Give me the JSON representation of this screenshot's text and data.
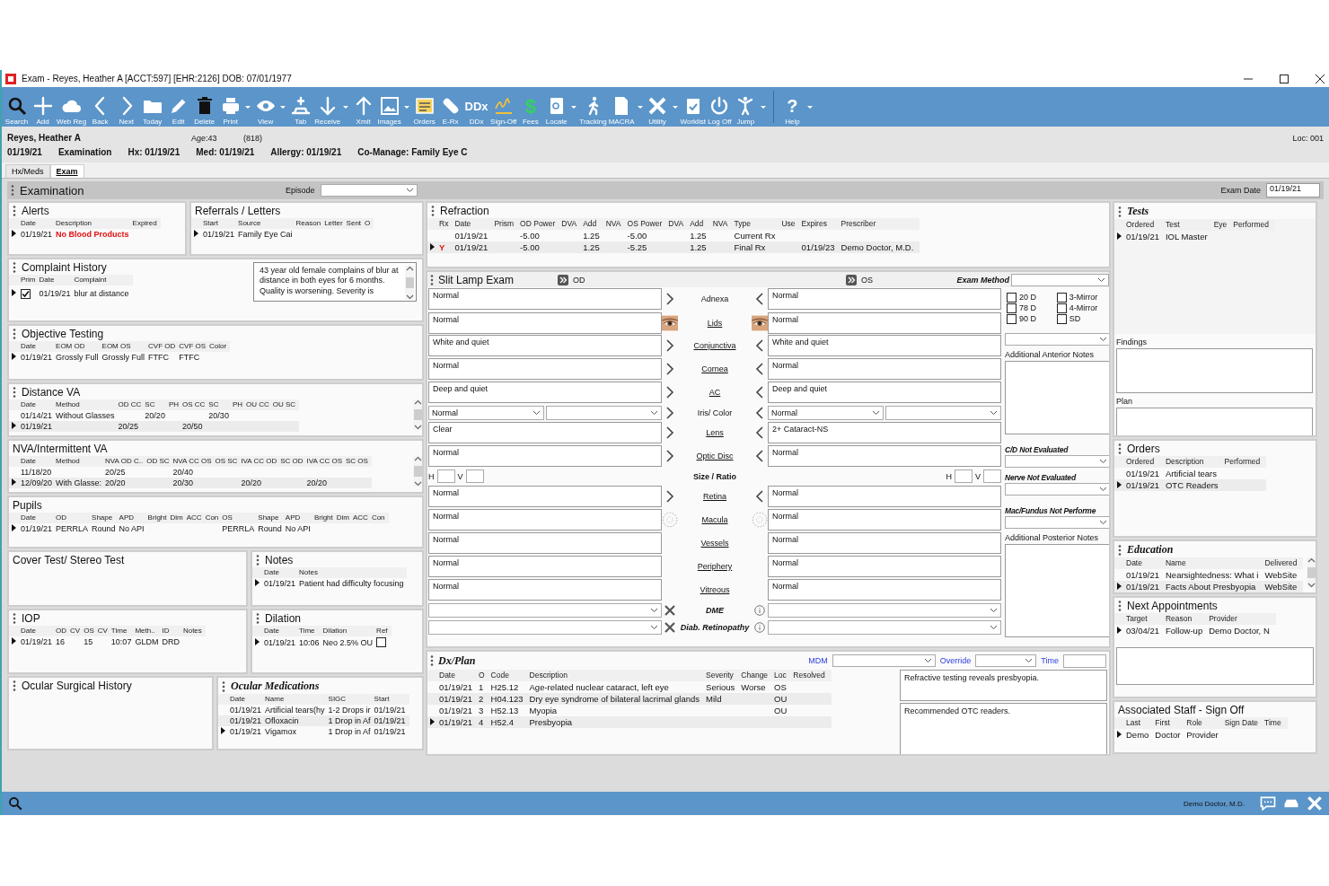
{
  "window": {
    "title": "Exam - Reyes, Heather A [ACCT:597] [EHR:2126]  DOB: 07/01/1977"
  },
  "toolbar": [
    {
      "label": "Search"
    },
    {
      "label": "Add"
    },
    {
      "label": "Web Reg"
    },
    {
      "label": "Back"
    },
    {
      "label": "Next"
    },
    {
      "label": "Today"
    },
    {
      "label": "Edit"
    },
    {
      "label": "Delete"
    },
    {
      "label": "Print",
      "dropdown": true
    },
    {
      "label": "View",
      "dropdown": true
    },
    {
      "label": "Tab"
    },
    {
      "label": "Receive",
      "dropdown": true
    },
    {
      "label": "Xmit"
    },
    {
      "label": "Images",
      "dropdown": true
    },
    {
      "label": "Orders"
    },
    {
      "label": "E-Rx"
    },
    {
      "label": "DDx",
      "glyph": "DDx"
    },
    {
      "label": "Sign-Off"
    },
    {
      "label": "Fees",
      "glyph": "$"
    },
    {
      "label": "Locate",
      "dropdown": true
    },
    {
      "label": "Tracking"
    },
    {
      "label": "MACRA",
      "dropdown": true
    },
    {
      "label": "Utility",
      "dropdown": true
    },
    {
      "label": "Worklist"
    },
    {
      "label": "Log Off"
    },
    {
      "label": "Jump",
      "dropdown": true
    },
    {
      "label": "Help",
      "glyph": "?",
      "dropdown": true,
      "divider_before": true
    }
  ],
  "patient": {
    "name": "Reyes, Heather A",
    "age": "Age:43",
    "phone": "(818)",
    "location": "Loc: 001",
    "date": "01/19/21",
    "visit": "Examination",
    "hx": "Hx: 01/19/21",
    "med": "Med: 01/19/21",
    "allergy": "Allergy: 01/19/21",
    "comanage": "Co-Manage: Family Eye C"
  },
  "tabs": [
    {
      "label": "Hx/Meds",
      "selected": false
    },
    {
      "label": "Exam",
      "selected": true
    }
  ],
  "exam": {
    "title": "Examination",
    "episode_label": "Episode",
    "date_label": "Exam Date",
    "date": "01/19/21"
  },
  "left": [
    [
      {
        "title": "Alerts",
        "handle": true,
        "kind": "grid",
        "columns": [
          "Date",
          "Description",
          "Expired"
        ],
        "rows": [
          {
            "selected": true,
            "cells": [
              "01/19/21",
              {
                "kind": "flag",
                "text": "No Blood Products"
              }
            ]
          }
        ]
      },
      {
        "title": "Referrals / Letters",
        "handle": false,
        "kind": "grid",
        "columns": [
          "Start",
          "Source",
          "Reason",
          "Letter",
          "Sent",
          "O"
        ],
        "rows": [
          {
            "selected": true,
            "cells": [
              "01/19/21",
              "Family Eye Cai"
            ]
          }
        ]
      }
    ],
    [
      {
        "title": "Complaint History",
        "handle": true,
        "kind": "note",
        "columns": [
          "Prim",
          "Date",
          "Complaint"
        ],
        "rows": [
          {
            "selected": true,
            "cells": [
              {
                "kind": "check",
                "checked": true
              },
              "01/19/21",
              "blur at distance"
            ]
          }
        ],
        "note": "43 year old female complains of blur at distance in both eyes for 6 months.  Quality is worsening.  Severity is"
      }
    ],
    [
      {
        "title": "Objective Testing",
        "handle": true,
        "kind": "grid",
        "columns": [
          "Date",
          "EOM OD",
          "EOM OS",
          "CVF OD",
          "CVF OS",
          "Color"
        ],
        "rows": [
          {
            "selected": true,
            "cells": [
              "01/19/21",
              "Grossly Full",
              "Grossly Full",
              "FTFC",
              "FTFC"
            ]
          }
        ]
      }
    ],
    [
      {
        "title": "Distance VA",
        "handle": true,
        "kind": "scroll",
        "columns": [
          "Date",
          "Method",
          "OD CC",
          "SC",
          "PH",
          "OS CC",
          "SC",
          "PH",
          "OU CC",
          "OU SC"
        ],
        "rows": [
          {
            "selected": false,
            "cells": [
              "01/14/21",
              "Without Glasses",
              null,
              "20/20",
              null,
              null,
              "20/30"
            ]
          },
          {
            "selected": true,
            "cells": [
              "01/19/21",
              null,
              "20/25",
              null,
              null,
              "20/50"
            ]
          }
        ]
      }
    ],
    [
      {
        "title": "NVA/Intermittent VA",
        "handle": false,
        "kind": "scroll",
        "columns": [
          "Date",
          "Method",
          "NVA OD C..",
          "OD SC",
          "NVA CC OS",
          "OS SC",
          "IVA CC OD",
          "SC OD",
          "IVA CC OS",
          "SC OS"
        ],
        "rows": [
          {
            "selected": false,
            "cells": [
              "11/18/20",
              null,
              "20/25",
              null,
              "20/40"
            ]
          },
          {
            "selected": true,
            "cells": [
              "12/09/20",
              "With Glasse:",
              "20/20",
              null,
              "20/30",
              null,
              "20/20",
              null,
              "20/20"
            ]
          }
        ]
      }
    ],
    [
      {
        "title": "Pupils",
        "handle": false,
        "kind": "grid",
        "columns": [
          "Date",
          "OD",
          "Shape",
          "APD",
          "Bright",
          "Dim",
          "ACC",
          "Con",
          "OS",
          "Shape",
          "APD",
          "Bright",
          "Dim",
          "ACC",
          "Con"
        ],
        "rows": [
          {
            "selected": true,
            "cells": [
              "01/19/21",
              "PERRLA",
              "Round",
              "No API",
              null,
              null,
              null,
              null,
              "PERRLA",
              "Round",
              "No API"
            ]
          }
        ]
      }
    ],
    [
      {
        "title": "Cover Test/ Stereo Test",
        "handle": false,
        "kind": "grid"
      },
      {
        "title": "Notes",
        "handle": true,
        "kind": "grid",
        "columns": [
          "Date",
          "Notes"
        ],
        "rows": [
          {
            "selected": true,
            "cells": [
              "01/19/21",
              "Patient had difficulty focusing"
            ]
          }
        ]
      }
    ],
    [
      {
        "title": "IOP",
        "handle": true,
        "kind": "grid",
        "columns": [
          "Date",
          "OD",
          "CV",
          "OS",
          "CV",
          "Time",
          "Meth..",
          "ID",
          "Notes"
        ],
        "rows": [
          {
            "selected": true,
            "cells": [
              "01/19/21",
              "16",
              null,
              "15",
              null,
              "10:07",
              "GLDM",
              "DRD"
            ]
          }
        ]
      },
      {
        "title": "Dilation",
        "handle": true,
        "kind": "grid",
        "columns": [
          "Date",
          "Time",
          "Dilation",
          "Ref"
        ],
        "rows": [
          {
            "selected": true,
            "cells": [
              "01/19/21",
              "10:06",
              "Neo 2.5% OU",
              {
                "kind": "check",
                "checked": false
              }
            ]
          }
        ]
      }
    ],
    [
      {
        "title": "Ocular Surgical History",
        "handle": true,
        "kind": "grid"
      },
      {
        "title": "Ocular Medications",
        "handle": true,
        "emphasis": true,
        "kind": "grid",
        "columns": [
          "Date",
          "Name",
          "SIGC",
          "Start"
        ],
        "rows": [
          {
            "selected": false,
            "cells": [
              "01/19/21",
              "Artificial tears(hy",
              "1-2 Drops ir",
              "01/19/21"
            ]
          },
          {
            "selected": false,
            "cells": [
              "01/19/21",
              "Ofloxacin",
              "1 Drop in Af",
              "01/19/21"
            ]
          },
          {
            "selected": true,
            "cells": [
              "01/19/21",
              "Vigamox",
              "1 Drop in Af",
              "01/19/21"
            ]
          }
        ]
      }
    ]
  ],
  "refraction": {
    "title": "Refraction",
    "handle": true,
    "kind": "grid",
    "columns": [
      "Rx",
      "Date",
      "Prism",
      "OD Power",
      "DVA",
      "Add",
      "NVA",
      "OS Power",
      "DVA",
      "Add",
      "NVA",
      "Type",
      "Use",
      "Expires",
      "Prescriber"
    ],
    "rows": [
      {
        "selected": false,
        "cells": [
          null,
          "01/19/21",
          null,
          "-5.00",
          null,
          "1.25",
          null,
          "-5.00",
          null,
          "1.25",
          null,
          "Current Rx"
        ]
      },
      {
        "selected": true,
        "cells": [
          {
            "kind": "flag",
            "text": "Y"
          },
          "01/19/21",
          null,
          "-5.00",
          null,
          "1.25",
          null,
          "-5.25",
          null,
          "1.25",
          null,
          "Final Rx",
          null,
          "01/19/23",
          "Demo Doctor, M.D."
        ]
      }
    ]
  },
  "slit_lamp": {
    "title": "Slit Lamp Exam",
    "od_label": "OD",
    "os_label": "OS",
    "method_label": "Exam Method",
    "rows": [
      {
        "label": "Adnexa",
        "kind": "arrow",
        "link": false,
        "od": "Normal",
        "os": "Normal"
      },
      {
        "label": "Lids",
        "kind": "eye",
        "link": true,
        "od": "Normal",
        "os": "Normal"
      },
      {
        "label": "Conjunctiva",
        "kind": "arrow",
        "link": true,
        "od": "White and quiet",
        "os": "White and quiet"
      },
      {
        "label": "Cornea",
        "kind": "arrow",
        "link": true,
        "od": "Normal",
        "os": "Normal"
      },
      {
        "label": "AC",
        "kind": "arrow",
        "link": true,
        "od": "Deep and quiet",
        "os": "Deep and quiet"
      },
      {
        "label": "Iris/ Color",
        "kind": "select",
        "link": false,
        "od": "Normal",
        "os": "Normal"
      },
      {
        "label": "Lens",
        "kind": "arrow",
        "link": true,
        "od": "Clear",
        "os": "2+ Cataract-NS"
      },
      {
        "label": "Optic Disc",
        "kind": "arrow",
        "link": true,
        "od": "Normal",
        "os": "Normal"
      },
      {
        "label": "Size / Ratio",
        "kind": "size",
        "link": false,
        "od_labels": [
          "H",
          "V"
        ],
        "os_labels": [
          "H",
          "V"
        ]
      },
      {
        "label": "Retina",
        "kind": "arrow",
        "link": true,
        "od": "Normal",
        "os": "Normal"
      },
      {
        "label": "Macula",
        "kind": "macula",
        "link": true,
        "od": "Normal",
        "os": "Normal"
      },
      {
        "label": "Vessels",
        "kind": "plain",
        "link": true,
        "od": "Normal",
        "os": "Normal"
      },
      {
        "label": "Periphery",
        "kind": "plain",
        "link": true,
        "od": "Normal",
        "os": "Normal"
      },
      {
        "label": "Vitreous",
        "kind": "plain",
        "link": true,
        "od": "Normal",
        "os": "Normal"
      },
      {
        "label": "DME",
        "kind": "grade",
        "link": false
      },
      {
        "label": "Diab. Retinopathy",
        "kind": "grade",
        "link": false
      }
    ],
    "lenses": [
      {
        "label": "20 D",
        "checked": false
      },
      {
        "label": "78 D",
        "checked": false
      },
      {
        "label": "90 D",
        "checked": false
      },
      {
        "label": "3-Mirror",
        "checked": false
      },
      {
        "label": "4-Mirror",
        "checked": false
      },
      {
        "label": "SD",
        "checked": false
      }
    ],
    "anterior_notes_label": "Additional Anterior Notes",
    "evaluations": [
      "C/D Not Evaluated",
      "Nerve Not Evaluated",
      "Mac/Fundus Not Performe"
    ],
    "posterior_notes_label": "Additional Posterior Notes"
  },
  "dx_plan": {
    "title": "Dx/Plan",
    "mdm_label": "MDM",
    "override_label": "Override",
    "time_label": "Time",
    "columns": [
      "Date",
      "O",
      "Code",
      "Description",
      "Severity",
      "Change",
      "Loc",
      "Resolved"
    ],
    "rows": [
      {
        "selected": false,
        "cells": [
          "01/19/21",
          "1",
          "H25.12",
          "Age-related nuclear cataract, left eye",
          "Serious",
          "Worse",
          "OS"
        ]
      },
      {
        "selected": false,
        "cells": [
          "01/19/21",
          "2",
          "H04.123",
          "Dry eye syndrome of bilateral lacrimal glands",
          "Mild",
          null,
          "OU"
        ]
      },
      {
        "selected": false,
        "cells": [
          "01/19/21",
          "3",
          "H52.13",
          "Myopia",
          null,
          null,
          "OU"
        ]
      },
      {
        "selected": true,
        "cells": [
          "01/19/21",
          "4",
          "H52.4",
          "Presbyopia"
        ]
      }
    ],
    "notes": [
      "Refractive testing reveals presbyopia.",
      "Recommended OTC readers."
    ]
  },
  "right": [
    {
      "title": "Tests",
      "handle": true,
      "emphasis": true,
      "kind": "findings",
      "columns": [
        "Ordered",
        "Test",
        "Eye",
        "Performed"
      ],
      "rows": [
        {
          "selected": true,
          "cells": [
            "01/19/21",
            "IOL Master"
          ]
        }
      ],
      "sections": [
        "Findings",
        "Plan"
      ]
    },
    {
      "title": "Orders",
      "handle": true,
      "kind": "grid",
      "columns": [
        "Ordered",
        "Description",
        "Performed"
      ],
      "rows": [
        {
          "selected": false,
          "cells": [
            "01/19/21",
            "Artificial tears"
          ]
        },
        {
          "selected": true,
          "cells": [
            "01/19/21",
            "OTC Readers"
          ]
        }
      ]
    },
    {
      "title": "Education",
      "handle": true,
      "emphasis": true,
      "kind": "scroll",
      "columns": [
        "Date",
        "Name",
        "Delivered"
      ],
      "rows": [
        {
          "selected": false,
          "cells": [
            "01/19/21",
            "Nearsightedness: What i",
            "WebSite"
          ]
        },
        {
          "selected": true,
          "cells": [
            "01/19/21",
            "Facts About Presbyopia",
            "WebSite"
          ]
        }
      ]
    },
    {
      "title": "Next Appointments",
      "handle": true,
      "kind": "box",
      "columns": [
        "Target",
        "Reason",
        "Provider"
      ],
      "rows": [
        {
          "selected": true,
          "cells": [
            "03/04/21",
            "Follow-up",
            "Demo Doctor, N"
          ]
        }
      ]
    },
    {
      "title": "Associated Staff - Sign Off",
      "handle": false,
      "kind": "grid",
      "columns": [
        "Last",
        "First",
        "Role",
        "Sign Date",
        "Time"
      ],
      "rows": [
        {
          "selected": true,
          "cells": [
            "Demo",
            "Doctor",
            "Provider"
          ]
        }
      ]
    }
  ],
  "status_bar": {
    "user": "Demo Doctor, M.D."
  }
}
